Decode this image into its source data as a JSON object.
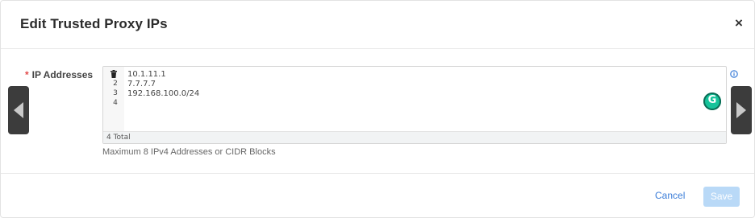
{
  "dialog": {
    "title": "Edit Trusted Proxy IPs",
    "close_label": "×"
  },
  "field": {
    "required_mark": "*",
    "label": "IP Addresses",
    "help_text": "Maximum 8 IPv4 Addresses or CIDR Blocks"
  },
  "editor": {
    "line_numbers": [
      "2",
      "3",
      "4"
    ],
    "lines": [
      "10.1.11.1",
      "7.7.7.7",
      "192.168.100.0/24",
      ""
    ],
    "total": "4 Total",
    "grammarly_label": "G"
  },
  "footer": {
    "cancel_label": "Cancel",
    "save_label": "Save"
  },
  "colors": {
    "primary": "#3b7dd8",
    "save_disabled": "#b9d9f7",
    "required": "#e24a4a"
  },
  "icons": {
    "close": "close-icon",
    "delete_line": "trash-icon",
    "info": "info-icon",
    "grammarly": "grammarly-icon",
    "prev": "arrow-left-icon",
    "next": "arrow-right-icon"
  }
}
